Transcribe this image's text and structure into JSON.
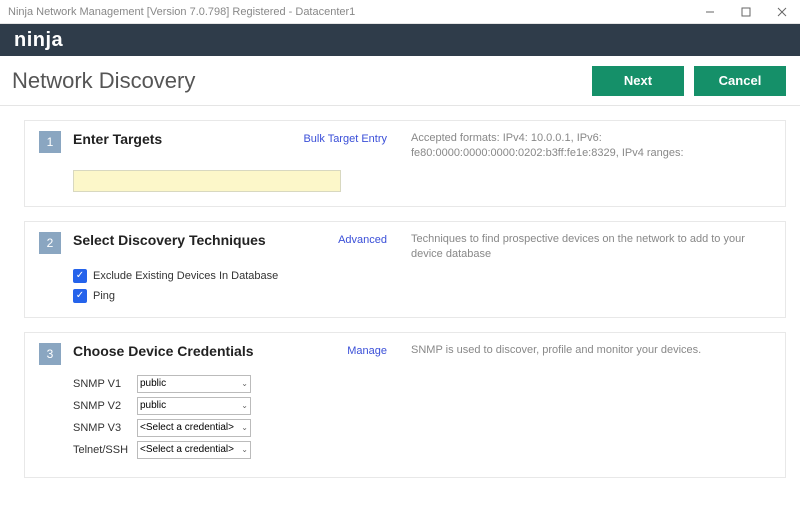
{
  "window": {
    "title": "Ninja Network Management [Version 7.0.798] Registered - Datacenter1"
  },
  "brand": "ninja",
  "page": {
    "title": "Network Discovery",
    "next": "Next",
    "cancel": "Cancel"
  },
  "step1": {
    "num": "1",
    "title": "Enter Targets",
    "link": "Bulk Target Entry",
    "desc": "Accepted formats: IPv4: 10.0.0.1, IPv6: fe80:0000:0000:0000:0202:b3ff:fe1e:8329, IPv4 ranges:",
    "value": ""
  },
  "step2": {
    "num": "2",
    "title": "Select Discovery Techniques",
    "link": "Advanced",
    "desc": "Techniques to find prospective devices on the network to add to your device database",
    "opt_exclude": "Exclude Existing Devices In Database",
    "opt_ping": "Ping"
  },
  "step3": {
    "num": "3",
    "title": "Choose Device Credentials",
    "link": "Manage",
    "desc": "SNMP is used to discover, profile and monitor your devices.",
    "rows": {
      "snmpv1": {
        "label": "SNMP V1",
        "value": "public"
      },
      "snmpv2": {
        "label": "SNMP V2",
        "value": "public"
      },
      "snmpv3": {
        "label": "SNMP V3",
        "value": "<Select a credential>"
      },
      "telnet": {
        "label": "Telnet/SSH",
        "value": "<Select a credential>"
      }
    }
  }
}
